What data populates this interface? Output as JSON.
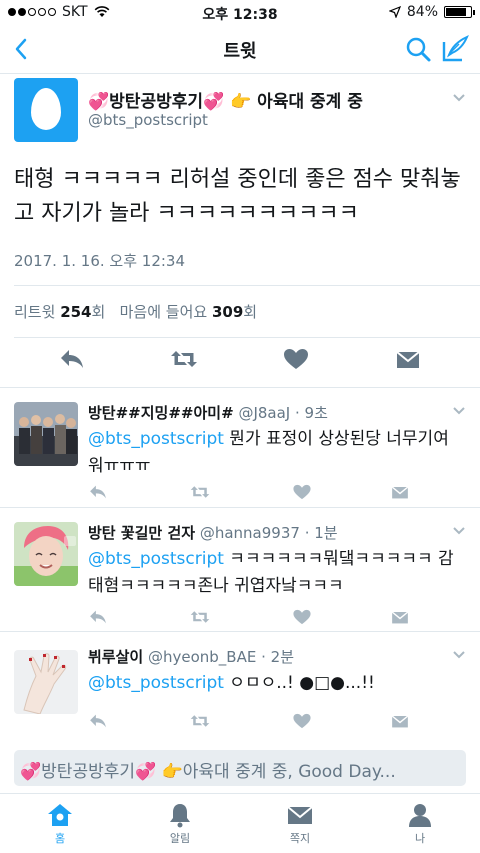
{
  "status": {
    "carrier": "SKT",
    "time": "오후 12:38",
    "battery": "84%",
    "battery_level": 0.84
  },
  "nav": {
    "title": "트윗"
  },
  "tweet": {
    "name": "💞방탄공방후기💞 👉 아육대 중계 중",
    "handle": "@bts_postscript",
    "text": "태형 ㅋㅋㅋㅋㅋ 리허설 중인데 좋은 점수 맞춰놓고 자기가 놀라 ㅋㅋㅋㅋㅋㅋㅋㅋㅋㅋ",
    "time": "2017. 1. 16. 오후 12:34",
    "retweet_label": "리트윗",
    "retweet_count": "254",
    "retweet_unit": "회",
    "like_label": "마음에 들어요",
    "like_count": "309",
    "like_unit": "회"
  },
  "replies": [
    {
      "name": "방탄##지밍##아미#",
      "handle": "@J8aaJ",
      "age": "· 9초",
      "mention": "@bts_postscript",
      "text": " 뭔가 표정이 상상된당 너무기여워ㅠㅠㅠ"
    },
    {
      "name": "방탄 꽃길만 걷자",
      "handle": "@hanna9937",
      "age": "· 1분",
      "mention": "@bts_postscript",
      "text": " ㅋㅋㅋㅋㅋㅋ뭐댘ㅋㅋㅋㅋㅋ 감태혐ㅋㅋㅋㅋㅋ존나 귀엽자낰ㅋㅋㅋ"
    },
    {
      "name": "뷔루살이",
      "handle": "@hyeonb_BAE",
      "age": "· 2분",
      "mention": "@bts_postscript",
      "text": " ㅇㅁㅇ..! ●□●...!!"
    }
  ],
  "compose": {
    "placeholder": "💞방탄공방후기💞 👉아육대 중계 중, Good Day..."
  },
  "tabs": [
    {
      "label": "홈",
      "icon": "home-icon"
    },
    {
      "label": "알림",
      "icon": "bell-icon"
    },
    {
      "label": "쪽지",
      "icon": "envelope-icon"
    },
    {
      "label": "나",
      "icon": "person-icon"
    }
  ],
  "colors": {
    "accent": "#1da1f2",
    "muted": "#657786",
    "icon_gray": "#aab8c2",
    "icon_dark": "#657786"
  }
}
